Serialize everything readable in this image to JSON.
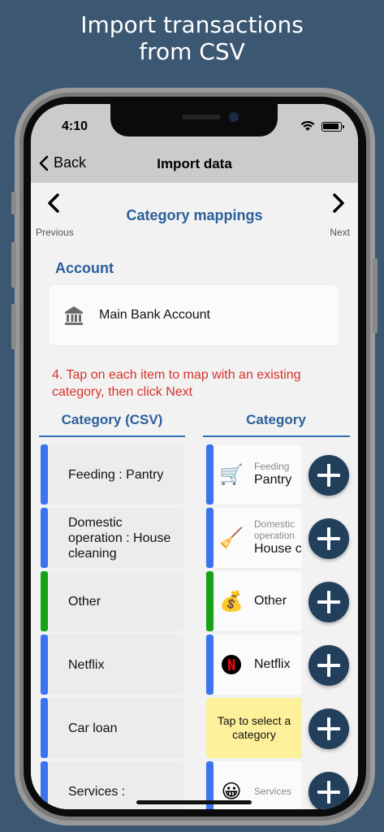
{
  "headline": {
    "line1": "Import transactions",
    "line2": "from CSV"
  },
  "status_bar": {
    "time": "4:10"
  },
  "nav": {
    "back_label": "Back",
    "title": "Import data"
  },
  "wizard": {
    "previous_label": "Previous",
    "next_label": "Next",
    "section_title": "Category mappings"
  },
  "account": {
    "heading": "Account",
    "name": "Main Bank Account",
    "icon": "bank-icon"
  },
  "instruction": "4. Tap on each item to map with an existing category, then click Next",
  "columns": {
    "csv": "Category (CSV)",
    "category": "Category"
  },
  "rows": [
    {
      "csv_label": "Feeding : Pantry",
      "bar_color": "#3b73f0",
      "category": {
        "icon": "shopping-cart-icon",
        "glyph": "🛒",
        "sub": "Feeding",
        "main": "Pantry"
      }
    },
    {
      "csv_label": "Domestic operation : House cleaning",
      "bar_color": "#3b73f0",
      "category": {
        "icon": "broom-icon",
        "glyph": "🧹",
        "sub": "Domestic operation",
        "main": "House cleanin"
      }
    },
    {
      "csv_label": "Other",
      "bar_color": "#16a116",
      "category": {
        "icon": "money-bag-icon",
        "glyph": "💰",
        "sub": "",
        "main": "Other"
      }
    },
    {
      "csv_label": "Netflix",
      "bar_color": "#3b73f0",
      "category": {
        "icon": "netflix-logo-icon",
        "glyph": "N",
        "sub": "",
        "main": "Netflix"
      }
    },
    {
      "csv_label": "Car loan",
      "bar_color": "#3b73f0",
      "category": null,
      "tap_hint": "Tap to select a category"
    },
    {
      "csv_label": "Services :",
      "bar_color": "#3b73f0",
      "category": {
        "icon": "services-icon",
        "glyph": "😀",
        "sub": "Services",
        "main": ""
      }
    }
  ]
}
